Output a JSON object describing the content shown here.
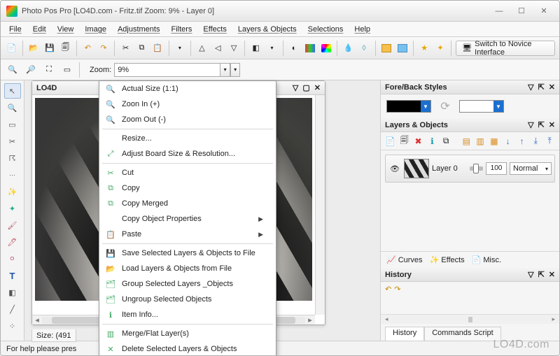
{
  "titlebar": {
    "title": "Photo Pos Pro  [LO4D.com - Fritz.tif Zoom: 9% - Layer 0]"
  },
  "menus": {
    "file": "File",
    "edit": "Edit",
    "view": "View",
    "image": "Image",
    "adjustments": "Adjustments",
    "filters": "Filters",
    "effects": "Effects",
    "layers": "Layers & Objects",
    "selections": "Selections",
    "help": "Help"
  },
  "toolbar": {
    "novice_label": "Switch to Novice Interface"
  },
  "zoom": {
    "label": "Zoom:",
    "value": "9%"
  },
  "doc": {
    "tab": "LO4D",
    "status": "Size: (491"
  },
  "context_menu": {
    "items": [
      {
        "icon": "🔍",
        "label": "Actual Size (1:1)"
      },
      {
        "icon": "🔍",
        "label": "Zoon In (+)"
      },
      {
        "icon": "🔍",
        "label": "Zoom Out (-)"
      },
      {
        "sep": true
      },
      {
        "icon": "",
        "label": "Resize..."
      },
      {
        "icon": "⤢",
        "label": "Adjust Board  Size & Resolution..."
      },
      {
        "sep": true
      },
      {
        "icon": "✂",
        "label": "Cut"
      },
      {
        "icon": "⧉",
        "label": "Copy"
      },
      {
        "icon": "⧉",
        "label": "Copy Merged"
      },
      {
        "icon": "",
        "label": "Copy Object Properties",
        "submenu": true
      },
      {
        "icon": "📋",
        "label": "Paste",
        "submenu": true
      },
      {
        "sep": true
      },
      {
        "icon": "💾",
        "label": "Save Selected Layers & Objects to File"
      },
      {
        "icon": "📂",
        "label": "Load Layers & Objects from File"
      },
      {
        "icon": "🗂",
        "label": "Group Selected Layers _Objects"
      },
      {
        "icon": "🗂",
        "label": "Ungroup Selected Objects"
      },
      {
        "icon": "ℹ",
        "label": "Item Info..."
      },
      {
        "sep": true
      },
      {
        "icon": "▥",
        "label": "Merge/Flat Layer(s)"
      },
      {
        "icon": "✕",
        "label": "Delete Selected Layers & Objects"
      }
    ]
  },
  "panel_foreback": {
    "title": "Fore/Back Styles"
  },
  "panel_layers": {
    "title": "Layers & Objects",
    "layer0": {
      "name": "Layer 0",
      "opacity": "100",
      "blend": "Normal"
    },
    "tabs": {
      "curves": "Curves",
      "effects": "Effects",
      "misc": "Misc."
    }
  },
  "panel_history": {
    "title": "History",
    "tab_history": "History",
    "tab_script": "Commands Script"
  },
  "statusbar": {
    "help": "For help please pres"
  },
  "watermark": "LO4D.com"
}
